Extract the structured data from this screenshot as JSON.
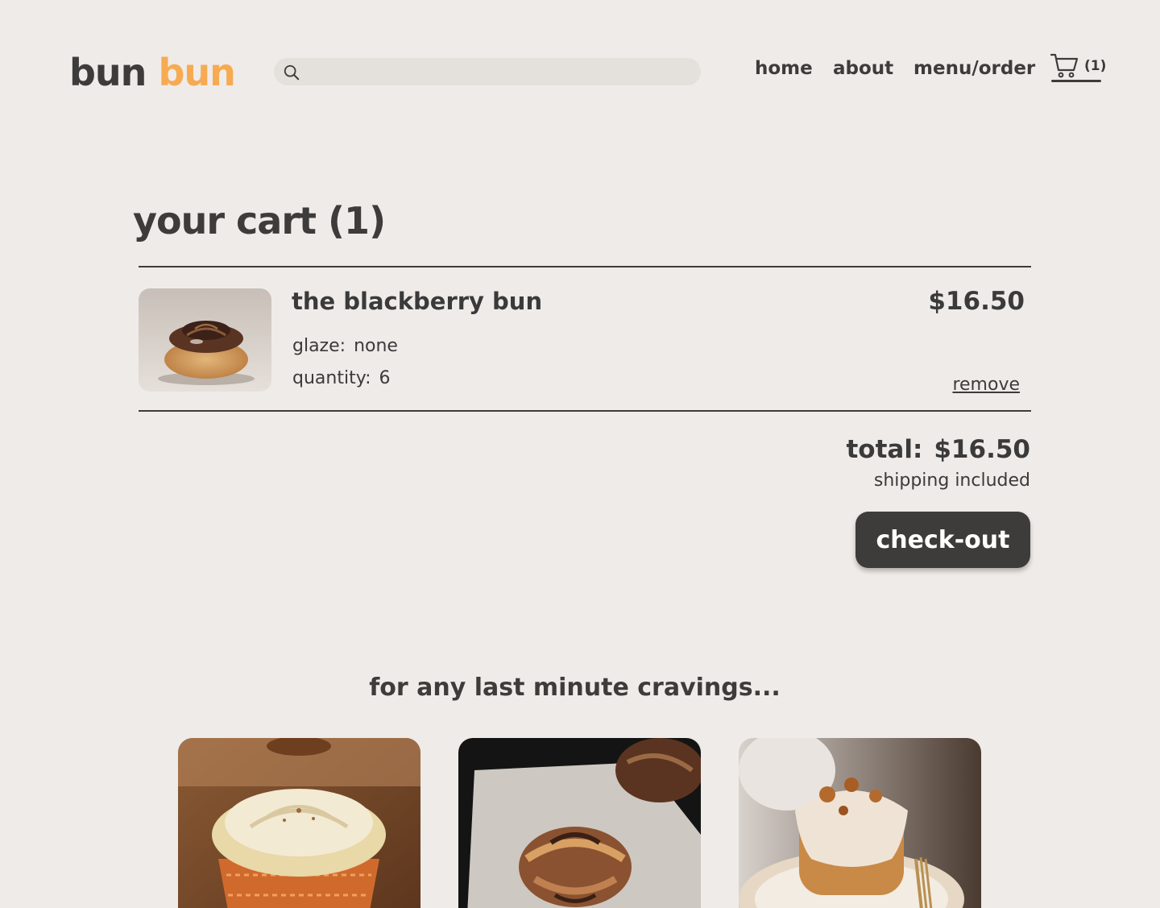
{
  "header": {
    "logo_part1": "bun",
    "logo_part2": "bun",
    "search_placeholder": "",
    "nav": {
      "home": "home",
      "about": "about",
      "menu": "menu/order"
    },
    "cart_count": "(1)"
  },
  "cart": {
    "title": "your cart (1)",
    "items": [
      {
        "name": "the blackberry bun",
        "price": "$16.50",
        "glaze_label": "glaze:",
        "glaze_value": "none",
        "quantity_label": "quantity:",
        "quantity_value": "6",
        "remove_label": "remove"
      }
    ],
    "total_label": "total:",
    "total_value": "$16.50",
    "shipping_note": "shipping included",
    "checkout_label": "check-out"
  },
  "suggestions": {
    "heading": "for any last minute cravings..."
  },
  "colors": {
    "background": "#efebe8",
    "text": "#3d3c3a",
    "accent": "#f6ab52",
    "button": "#3d3c3a"
  }
}
